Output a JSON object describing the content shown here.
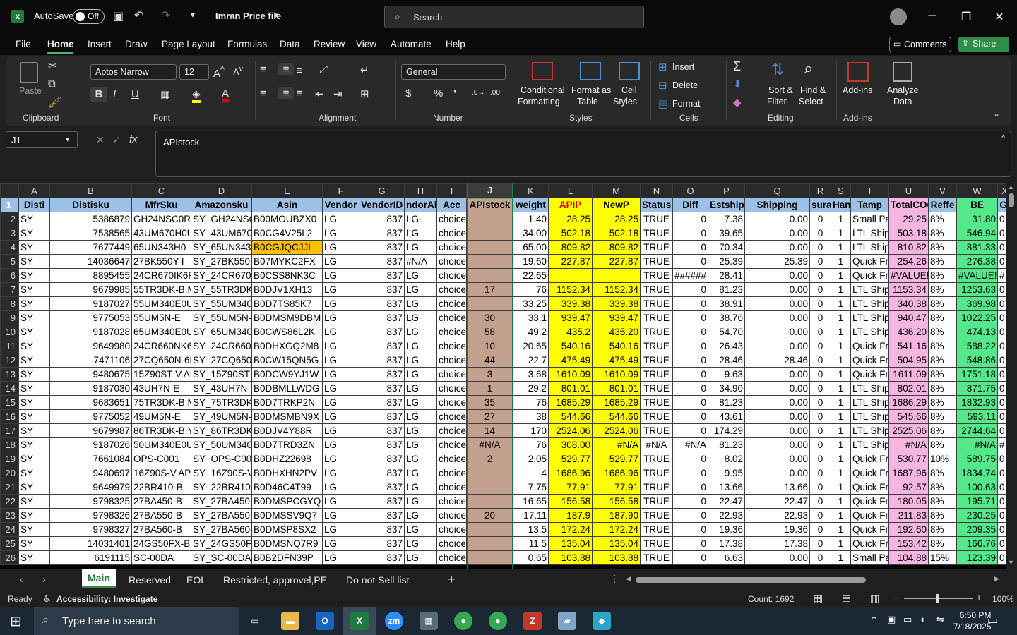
{
  "titlebar": {
    "autosave_label": "AutoSave",
    "autosave_state": "Off",
    "file_name": "Imran Price file",
    "search_placeholder": "Search"
  },
  "menu": {
    "items": [
      "File",
      "Home",
      "Insert",
      "Draw",
      "Page Layout",
      "Formulas",
      "Data",
      "Review",
      "View",
      "Automate",
      "Help"
    ],
    "active": "Home",
    "comments": "Comments",
    "share": "Share"
  },
  "ribbon": {
    "clipboard": {
      "label": "Clipboard",
      "paste": "Paste"
    },
    "font": {
      "label": "Font",
      "family": "Aptos Narrow",
      "size": "12"
    },
    "alignment": {
      "label": "Alignment"
    },
    "number": {
      "label": "Number",
      "format": "General"
    },
    "styles": {
      "label": "Styles",
      "conditional": "Conditional",
      "conditional2": "Formatting",
      "format_as": "Format as",
      "format_as2": "Table",
      "cell": "Cell",
      "cell2": "Styles"
    },
    "cells": {
      "label": "Cells",
      "insert": "Insert",
      "delete": "Delete",
      "format": "Format"
    },
    "editing": {
      "label": "Editing",
      "sort": "Sort &",
      "sort2": "Filter",
      "find": "Find &",
      "find2": "Select"
    },
    "addins": {
      "label": "Add-ins",
      "addins": "Add-ins",
      "analyze": "Analyze",
      "analyze2": "Data"
    }
  },
  "formula_bar": {
    "name_box": "J1",
    "content": "APIstock"
  },
  "grid": {
    "columns": [
      "A",
      "B",
      "C",
      "D",
      "E",
      "F",
      "G",
      "H",
      "I",
      "J",
      "K",
      "L",
      "M",
      "N",
      "O",
      "P",
      "Q",
      "R",
      "S",
      "T",
      "U",
      "V",
      "W",
      "X"
    ],
    "header": [
      "Disti",
      "Distisku",
      "MfrSku",
      "Amazonsku",
      "Asin",
      "Vendor",
      "VendorID",
      "ndorAll",
      "Acc",
      "APIstock",
      "weight",
      "APIP",
      "NewP",
      "Status",
      "Diff",
      "Estship",
      "Shipping",
      "suran",
      "Han",
      "Tamp",
      "TotalCOG",
      "Reffe",
      "BE",
      "GI"
    ],
    "rows": [
      [
        "SY",
        "5386879",
        "GH24NSC0R",
        "SY_GH24NSC0",
        "B00MOUBZX0",
        "LG",
        "837",
        "LG",
        "choice",
        "",
        "1.40",
        "28.25",
        "28.25",
        "TRUE",
        "0",
        "7.38",
        "0.00",
        "0",
        "1",
        "Small Pa",
        "29.25",
        "8%",
        "31.80",
        "0"
      ],
      [
        "SY",
        "7538565",
        "43UM670H0U",
        "SY_43UM670H",
        "B0CG4V25L2",
        "LG",
        "837",
        "LG",
        "choice",
        "",
        "34.00",
        "502.18",
        "502.18",
        "TRUE",
        "0",
        "39.65",
        "0.00",
        "0",
        "1",
        "LTL Ship",
        "503.18",
        "8%",
        "546.94",
        "0"
      ],
      [
        "SY",
        "7677449",
        "65UN343H0",
        "SY_65UN343H",
        "B0CGJQCJJL",
        "LG",
        "837",
        "LG",
        "choice",
        "",
        "65.00",
        "809.82",
        "809.82",
        "TRUE",
        "0",
        "70.34",
        "0.00",
        "0",
        "1",
        "LTL Ship",
        "810.82",
        "8%",
        "881.33",
        "0"
      ],
      [
        "SY",
        "14036647",
        "27BK550Y-I",
        "SY_27BK550Y-",
        "B07MYKC2FX",
        "LG",
        "837",
        "#N/A",
        "choice",
        "",
        "19.60",
        "227.87",
        "227.87",
        "TRUE",
        "0",
        "25.39",
        "25.39",
        "0",
        "1",
        "Quick Fr",
        "254.26",
        "8%",
        "276.38",
        "0"
      ],
      [
        "SY",
        "8895455",
        "24CR670IK6P",
        "SY_24CR670IK",
        "B0CSS8NK3C",
        "LG",
        "837",
        "LG",
        "choice",
        "",
        "22.65",
        "",
        "",
        "TRUE",
        "######",
        "28.41",
        "0.00",
        "0",
        "1",
        "Quick Fr",
        "#VALUE!",
        "8%",
        "#VALUE!",
        "#"
      ],
      [
        "SY",
        "9679985",
        "55TR3DK-B.M",
        "SY_55TR3DK-B",
        "B0DJV1XH13",
        "LG",
        "837",
        "LG",
        "choice",
        "17",
        "76",
        "1152.34",
        "1152.34",
        "TRUE",
        "0",
        "81.23",
        "0.00",
        "0",
        "1",
        "LTL Ship",
        "1153.34",
        "8%",
        "1253.63",
        "0"
      ],
      [
        "SY",
        "9187027",
        "55UM340E0U",
        "SY_55UM340E",
        "B0D7TS85K7",
        "LG",
        "837",
        "LG",
        "choice",
        "",
        "33.25",
        "339.38",
        "339.38",
        "TRUE",
        "0",
        "38.91",
        "0.00",
        "0",
        "1",
        "LTL Ship",
        "340.38",
        "8%",
        "369.98",
        "0"
      ],
      [
        "SY",
        "9775053",
        "55UM5N-E",
        "SY_55UM5N-E",
        "B0DMSM9DBM",
        "LG",
        "837",
        "LG",
        "choice",
        "30",
        "33.1",
        "939.47",
        "939.47",
        "TRUE",
        "0",
        "38.76",
        "0.00",
        "0",
        "1",
        "LTL Ship",
        "940.47",
        "8%",
        "1022.25",
        "0"
      ],
      [
        "SY",
        "9187028",
        "65UM340E0U",
        "SY_65UM340E",
        "B0CWS86L2K",
        "LG",
        "837",
        "LG",
        "choice",
        "58",
        "49.2",
        "435.2",
        "435.20",
        "TRUE",
        "0",
        "54.70",
        "0.00",
        "0",
        "1",
        "LTL Ship",
        "436.20",
        "8%",
        "474.13",
        "0"
      ],
      [
        "SY",
        "9649980",
        "24CR660NK6P",
        "SY_24CR660N",
        "B0DHXGQ2M8",
        "LG",
        "837",
        "LG",
        "choice",
        "10",
        "20.65",
        "540.16",
        "540.16",
        "TRUE",
        "0",
        "26.43",
        "0.00",
        "0",
        "1",
        "Quick Fr",
        "541.16",
        "8%",
        "588.22",
        "0"
      ],
      [
        "SY",
        "7471106",
        "27CQ650N-6N",
        "SY_27CQ650N",
        "B0CW15QN5G",
        "LG",
        "837",
        "LG",
        "choice",
        "44",
        "22.7",
        "475.49",
        "475.49",
        "TRUE",
        "0",
        "28.46",
        "28.46",
        "0",
        "1",
        "Quick Fr",
        "504.95",
        "8%",
        "548.86",
        "0"
      ],
      [
        "SY",
        "9480675",
        "15Z90ST-V.AP",
        "SY_15Z90ST-V",
        "B0DCW9YJ1W",
        "LG",
        "837",
        "LG",
        "choice",
        "3",
        "3.68",
        "1610.09",
        "1610.09",
        "TRUE",
        "0",
        "9.63",
        "0.00",
        "0",
        "1",
        "Quick Fr",
        "1611.09",
        "8%",
        "1751.18",
        "0"
      ],
      [
        "SY",
        "9187030",
        "43UH7N-E",
        "SY_43UH7N-E",
        "B0DBMLLWDG",
        "LG",
        "837",
        "LG",
        "choice",
        "1",
        "29.2",
        "801.01",
        "801.01",
        "TRUE",
        "0",
        "34.90",
        "0.00",
        "0",
        "1",
        "LTL Ship",
        "802.01",
        "8%",
        "871.75",
        "0"
      ],
      [
        "SY",
        "9683651",
        "75TR3DK-B.M",
        "SY_75TR3DK-B",
        "B0D7TRKP2N",
        "LG",
        "837",
        "LG",
        "choice",
        "35",
        "76",
        "1685.29",
        "1685.29",
        "TRUE",
        "0",
        "81.23",
        "0.00",
        "0",
        "1",
        "LTL Ship",
        "1686.29",
        "8%",
        "1832.93",
        "0"
      ],
      [
        "SY",
        "9775052",
        "49UM5N-E",
        "SY_49UM5N-E",
        "B0DMSMBN9X",
        "LG",
        "837",
        "LG",
        "choice",
        "27",
        "38",
        "544.66",
        "544.66",
        "TRUE",
        "0",
        "43.61",
        "0.00",
        "0",
        "1",
        "LTL Ship",
        "545.66",
        "8%",
        "593.11",
        "0"
      ],
      [
        "SY",
        "9679987",
        "86TR3DK-B.Y",
        "SY_86TR3DK-B",
        "B0DJV4Y88R",
        "LG",
        "837",
        "LG",
        "choice",
        "14",
        "170",
        "2524.06",
        "2524.06",
        "TRUE",
        "0",
        "174.29",
        "0.00",
        "0",
        "1",
        "LTL Ship",
        "2525.06",
        "8%",
        "2744.64",
        "0"
      ],
      [
        "SY",
        "9187026",
        "50UM340E0U",
        "SY_50UM340E",
        "B0D7TRD3ZN",
        "LG",
        "837",
        "LG",
        "choice",
        "#N/A",
        "76",
        "308.00",
        "#N/A",
        "#N/A",
        "#N/A",
        "81.23",
        "0.00",
        "0",
        "1",
        "LTL Ship",
        "#N/A",
        "8%",
        "#N/A",
        "#"
      ],
      [
        "SY",
        "7661084",
        "OPS-C001",
        "SY_OPS-C001",
        "B0DHZ22698",
        "LG",
        "837",
        "LG",
        "choice",
        "2",
        "2.05",
        "529.77",
        "529.77",
        "TRUE",
        "0",
        "8.02",
        "0.00",
        "0",
        "1",
        "Quick Fr",
        "530.77",
        "10%",
        "589.75",
        "0"
      ],
      [
        "SY",
        "9480697",
        "16Z90S-V.APC",
        "SY_16Z90S-V.",
        "B0DHXHN2PV",
        "LG",
        "837",
        "LG",
        "choice",
        "",
        "4",
        "1686.96",
        "1686.96",
        "TRUE",
        "0",
        "9.95",
        "0.00",
        "0",
        "1",
        "Quick Fr",
        "1687.96",
        "8%",
        "1834.74",
        "0"
      ],
      [
        "SY",
        "9649979",
        "22BR410-B",
        "SY_22BR410-B",
        "B0D46C4T99",
        "LG",
        "837",
        "LG",
        "choice",
        "",
        "7.75",
        "77.91",
        "77.91",
        "TRUE",
        "0",
        "13.66",
        "13.66",
        "0",
        "1",
        "Quick Fr",
        "92.57",
        "8%",
        "100.63",
        "0"
      ],
      [
        "SY",
        "9798325",
        "27BA450-B",
        "SY_27BA450-B",
        "B0DMSPCGYQ",
        "LG",
        "837",
        "LG",
        "choice",
        "",
        "16.65",
        "156.58",
        "156.58",
        "TRUE",
        "0",
        "22.47",
        "22.47",
        "0",
        "1",
        "Quick Fr",
        "180.05",
        "8%",
        "195.71",
        "0"
      ],
      [
        "SY",
        "9798326",
        "27BA550-B",
        "SY_27BA550-B",
        "B0DMSSV9Q7",
        "LG",
        "837",
        "LG",
        "choice",
        "20",
        "17.11",
        "187.9",
        "187.90",
        "TRUE",
        "0",
        "22.93",
        "22.93",
        "0",
        "1",
        "Quick Fr",
        "211.83",
        "8%",
        "230.25",
        "0"
      ],
      [
        "SY",
        "9798327",
        "27BA560-B",
        "SY_27BA560-B",
        "B0DMSP8SX2",
        "LG",
        "837",
        "LG",
        "choice",
        "",
        "13.5",
        "172.24",
        "172.24",
        "TRUE",
        "0",
        "19.36",
        "19.36",
        "0",
        "1",
        "Quick Fr",
        "192.60",
        "8%",
        "209.35",
        "0"
      ],
      [
        "SY",
        "14031401",
        "24GS50FX-B",
        "SY_24GS50FX-",
        "B0DMSNQ7R9",
        "LG",
        "837",
        "LG",
        "choice",
        "",
        "11.5",
        "135.04",
        "135.04",
        "TRUE",
        "0",
        "17.38",
        "17.38",
        "0",
        "1",
        "Quick Fr",
        "153.42",
        "8%",
        "166.76",
        "0"
      ],
      [
        "SY",
        "6191115",
        "SC-00DA",
        "SY_SC-00DA",
        "B0B2DFN39P",
        "LG",
        "837",
        "LG",
        "choice",
        "",
        "0.65",
        "103.88",
        "103.88",
        "TRUE",
        "0",
        "6.63",
        "0.00",
        "0",
        "1",
        "Small Pa",
        "104.88",
        "15%",
        "123.39",
        "0"
      ]
    ]
  },
  "sheets": {
    "tabs": [
      "Main",
      "Reserved",
      "EOL",
      "Restricted, approvel,PE",
      "Do not Sell list"
    ],
    "active": "Main"
  },
  "status": {
    "ready": "Ready",
    "accessibility": "Accessibility: Investigate",
    "count": "Count: 1692",
    "zoom": "100%"
  },
  "taskbar": {
    "search": "Type here to search",
    "time": "6:50 PM",
    "date": "7/18/2025"
  },
  "colors": {
    "excel_green": "#1e7b3f",
    "header_blue": "#9bc2e6",
    "yellow": "#ffff00",
    "pink": "#f4b6e0",
    "green": "#55e88a",
    "api_brown": "#c4a08f"
  }
}
